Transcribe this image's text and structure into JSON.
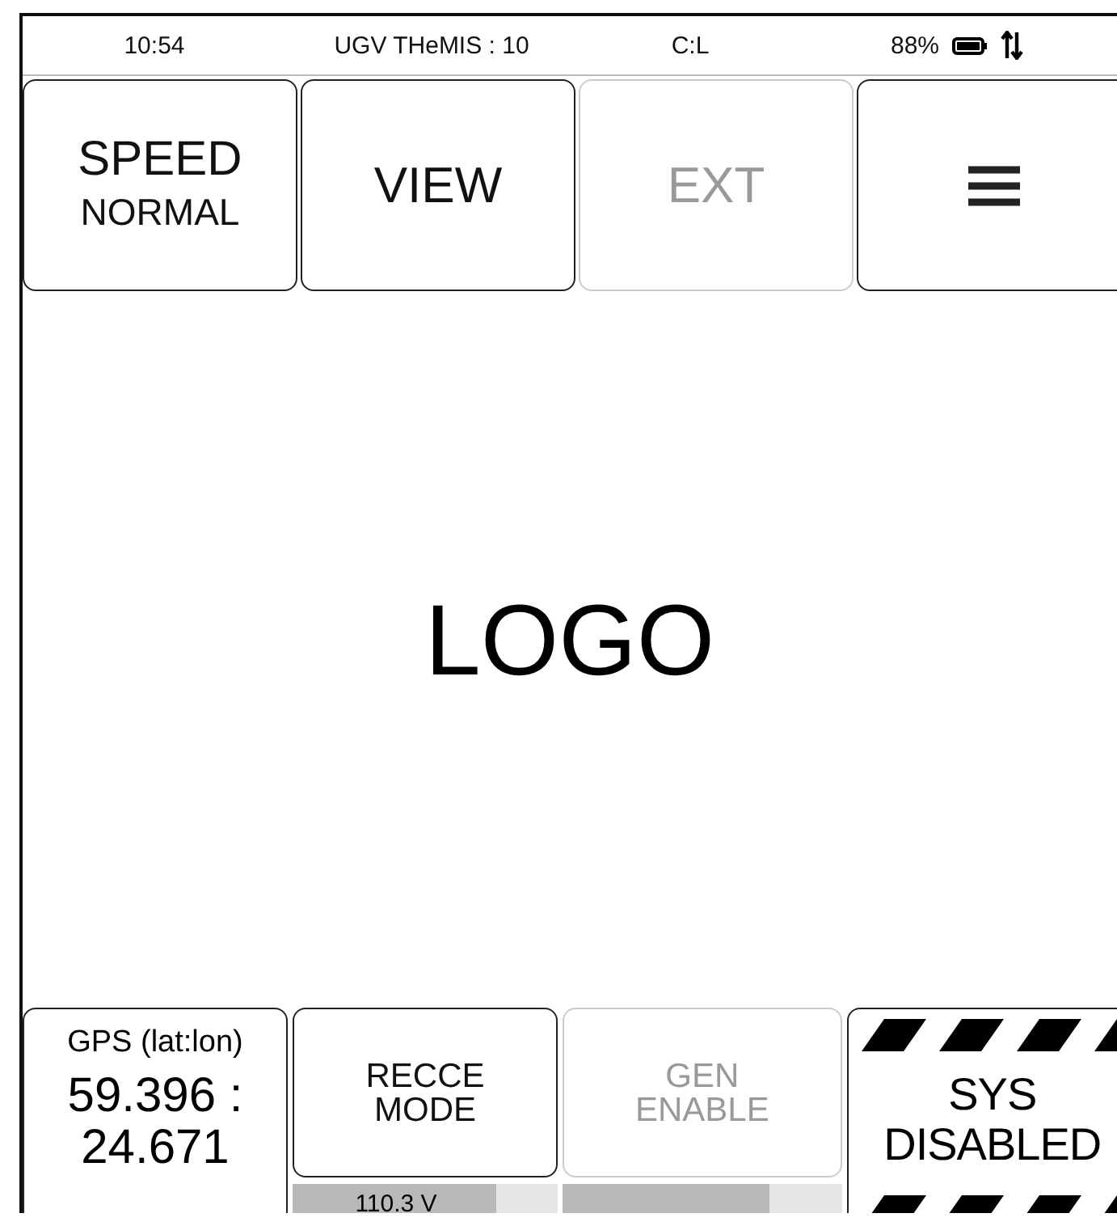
{
  "status_bar": {
    "time": "10:54",
    "vehicle": "UGV THeMIS : 10",
    "control": "C:L",
    "battery": "88%"
  },
  "top_buttons": [
    {
      "kind": "double",
      "title": "SPEED",
      "subtitle": "NORMAL",
      "disabled": false
    },
    {
      "kind": "single",
      "label": "VIEW",
      "disabled": false
    },
    {
      "kind": "single",
      "label": "EXT",
      "disabled": true
    },
    {
      "kind": "menu",
      "disabled": false
    }
  ],
  "logo": "LOGO",
  "gps": {
    "label": "GPS (lat:lon)",
    "lat": "59.396 :",
    "lon": "24.671"
  },
  "recce": {
    "label": "RECCE MODE",
    "disabled": false,
    "level": 0.77,
    "reading": "110.3 V"
  },
  "generator": {
    "label": "GEN ENABLE",
    "disabled": true,
    "level": 0.74
  },
  "system": {
    "label": "SYS DISABLED"
  }
}
